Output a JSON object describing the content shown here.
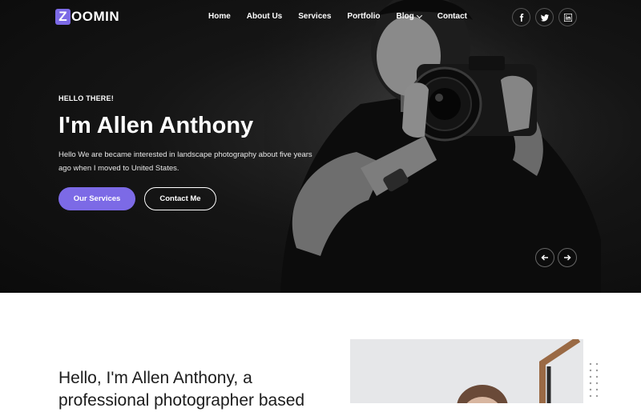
{
  "brand": {
    "logo_letter": "Z",
    "logo_rest": "OOMIN",
    "accent": "#7c6ae6"
  },
  "nav": {
    "items": [
      {
        "label": "Home"
      },
      {
        "label": "About Us"
      },
      {
        "label": "Services"
      },
      {
        "label": "Portfolio"
      },
      {
        "label": "Blog"
      },
      {
        "label": "Contact"
      }
    ],
    "socials": [
      {
        "icon": "facebook-icon"
      },
      {
        "icon": "twitter-icon"
      },
      {
        "icon": "linkedin-icon"
      }
    ]
  },
  "hero": {
    "greeting": "HELLO THERE!",
    "title": "I'm Allen Anthony",
    "description": "Hello We are became interested in landscape photography about five years ago when I moved to United States.",
    "primary_button": "Our Services",
    "secondary_button": "Contact Me",
    "slider_prev_icon": "arrow-left-icon",
    "slider_next_icon": "arrow-right-icon"
  },
  "about": {
    "line1": "Hello, I'm Allen Anthony, a",
    "line2": "professional photographer based"
  }
}
